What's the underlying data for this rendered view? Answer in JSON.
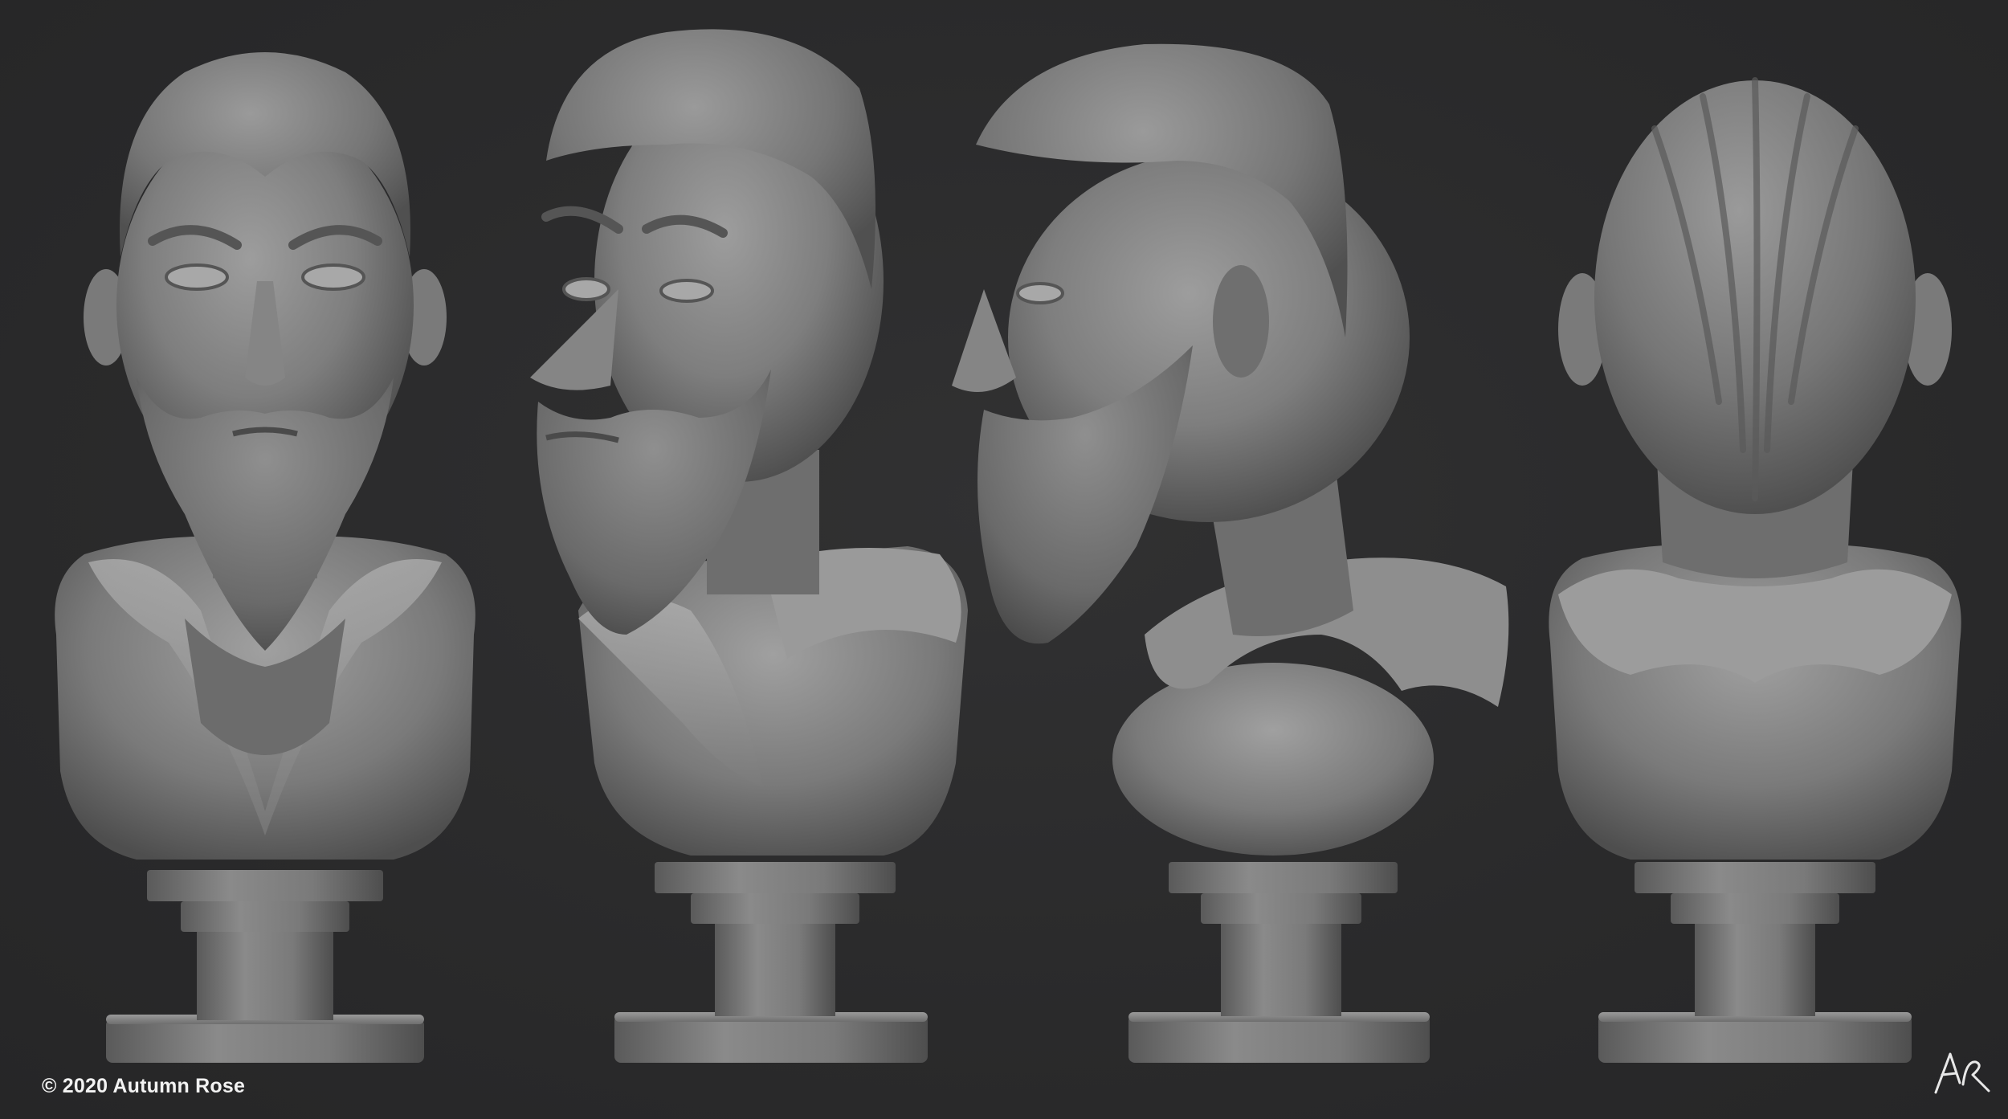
{
  "image": {
    "background_color": "#2a2a2b",
    "sculpt_color": "#8c8c8c",
    "views": [
      {
        "id": "front"
      },
      {
        "id": "three-quarter"
      },
      {
        "id": "profile"
      },
      {
        "id": "back"
      }
    ]
  },
  "footer": {
    "copyright": "© 2020 Autumn Rose",
    "signature_initials": "AR"
  }
}
